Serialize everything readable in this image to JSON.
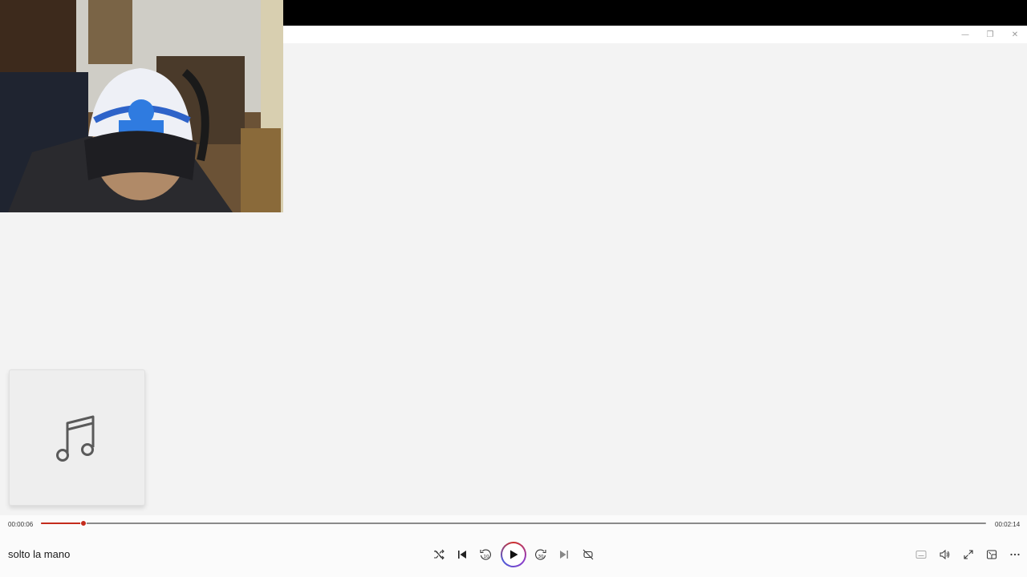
{
  "window": {
    "minimize_glyph": "—",
    "maximize_glyph": "❐",
    "close_glyph": "✕"
  },
  "player": {
    "current_time": "00:00:06",
    "total_time": "00:02:14",
    "progress_fraction": 0.045,
    "song_title": "solto la mano",
    "accent_color": "#c42b1c"
  },
  "icons": {
    "album_art": "music-note-icon",
    "shuffle": "shuffle-icon",
    "previous": "previous-track-icon",
    "rewind": "rewind-10-icon",
    "play": "play-icon",
    "forward": "forward-30-icon",
    "next": "next-track-icon",
    "repeat": "repeat-off-icon",
    "captions": "captions-icon",
    "volume": "volume-icon",
    "fullscreen": "fullscreen-icon",
    "miniplayer": "miniplayer-icon",
    "more": "more-options-icon"
  }
}
